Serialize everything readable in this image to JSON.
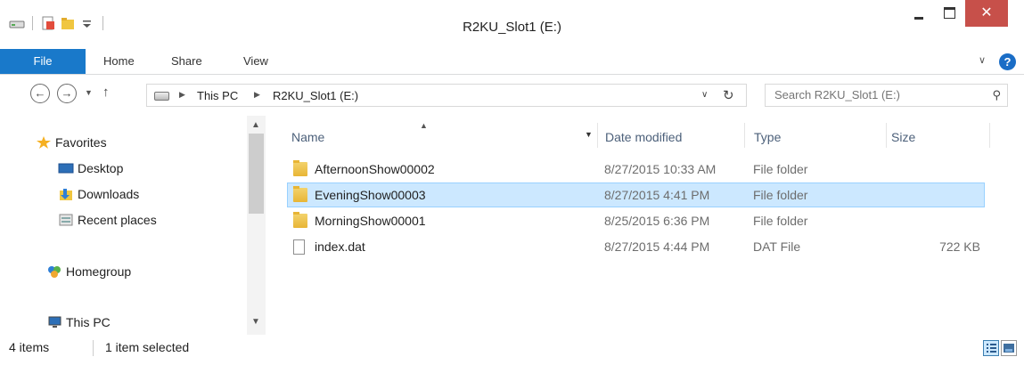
{
  "window": {
    "title": "R2KU_Slot1 (E:)",
    "close_glyph": "✕"
  },
  "ribbon": {
    "tabs": [
      {
        "label": "File"
      },
      {
        "label": "Home"
      },
      {
        "label": "Share"
      },
      {
        "label": "View"
      }
    ]
  },
  "navigation": {
    "breadcrumb": [
      {
        "label": "This PC"
      },
      {
        "label": "R2KU_Slot1 (E:)"
      }
    ],
    "search_placeholder": "Search R2KU_Slot1 (E:)"
  },
  "nav_pane": {
    "items": [
      {
        "label": "Favorites",
        "icon": "star-icon"
      },
      {
        "label": "Desktop",
        "icon": "desktop-icon"
      },
      {
        "label": "Downloads",
        "icon": "downloads-icon"
      },
      {
        "label": "Recent places",
        "icon": "recent-places-icon"
      },
      {
        "label": "Homegroup",
        "icon": "homegroup-icon"
      },
      {
        "label": "This PC",
        "icon": "computer-icon"
      }
    ]
  },
  "file_list": {
    "columns": [
      {
        "label": "Name"
      },
      {
        "label": "Date modified"
      },
      {
        "label": "Type"
      },
      {
        "label": "Size"
      }
    ],
    "rows": [
      {
        "name": "AfternoonShow00002",
        "date": "8/27/2015 10:33 AM",
        "type": "File folder",
        "size": "",
        "icon": "folder-icon",
        "selected": false
      },
      {
        "name": "EveningShow00003",
        "date": "8/27/2015 4:41 PM",
        "type": "File folder",
        "size": "",
        "icon": "folder-icon",
        "selected": true
      },
      {
        "name": "MorningShow00001",
        "date": "8/25/2015 6:36 PM",
        "type": "File folder",
        "size": "",
        "icon": "folder-icon",
        "selected": false
      },
      {
        "name": "index.dat",
        "date": "8/27/2015 4:44 PM",
        "type": "DAT File",
        "size": "722 KB",
        "icon": "file-icon",
        "selected": false
      }
    ]
  },
  "status": {
    "item_count": "4 items",
    "selection": "1 item selected"
  },
  "colors": {
    "accent": "#1979ca",
    "selection_bg": "#cce8ff",
    "selection_border": "#99d1ff",
    "close_button": "#c7504a"
  }
}
